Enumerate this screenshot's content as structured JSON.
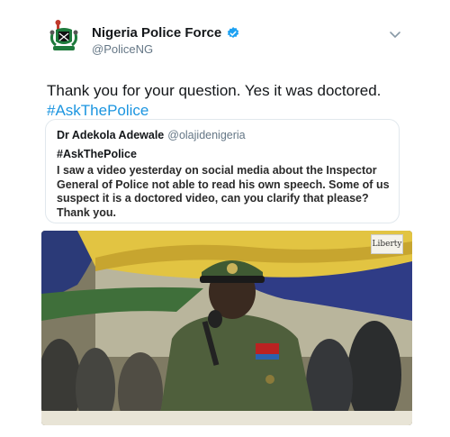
{
  "author": {
    "display_name": "Nigeria Police Force",
    "handle": "@PoliceNG",
    "verified": true,
    "avatar_icon": "police-crest-icon"
  },
  "tweet": {
    "text": "Thank you for your question. Yes it was doctored.",
    "hashtag": "#AskThePolice"
  },
  "quoted_tweet": {
    "display_name": "Dr Adekola Adewale",
    "handle": "@olajidenigeria",
    "hashtag": "#AskThePolice",
    "text": "I saw a video yesterday on social media about the Inspector General of Police not able to read his own speech. Some of us suspect it is a doctored video, can you clarify that please? Thank you."
  },
  "media": {
    "watermark": "Liberty"
  },
  "colors": {
    "link": "#1b95e0",
    "verified": "#1da1f2",
    "muted": "#657786"
  }
}
